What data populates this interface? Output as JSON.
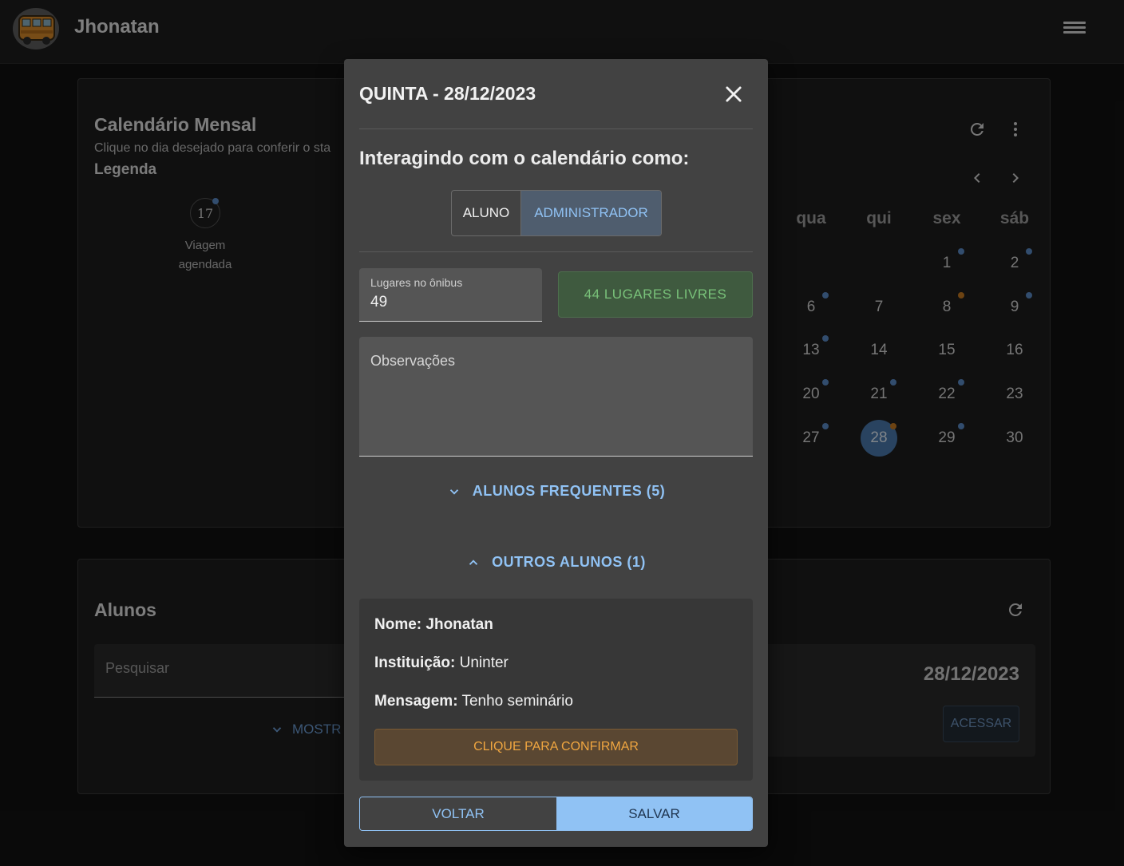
{
  "app": {
    "title": "Jhonatan"
  },
  "calendar": {
    "title": "Calendário Mensal",
    "subtitle": "Clique no dia desejado para conferir o sta",
    "legend_title": "Legenda",
    "legend_day": "17",
    "legend_label": "Viagem agendada",
    "weekdays": [
      "qua",
      "qui",
      "sex",
      "sáb"
    ],
    "rows": [
      [
        "",
        "",
        "1",
        "2"
      ],
      [
        "6",
        "7",
        "8",
        "9"
      ],
      [
        "13",
        "14",
        "15",
        "16"
      ],
      [
        "20",
        "21",
        "22",
        "23"
      ],
      [
        "27",
        "28",
        "29",
        "30"
      ]
    ],
    "selected_day": "28",
    "colors": {
      "scheduled": "#5b8dc9",
      "pending": "#c77a22",
      "selected": "#4b7bb0"
    }
  },
  "alunos": {
    "title": "Alunos",
    "search_placeholder": "Pesquisar",
    "show_more": "MOSTR",
    "trip_date": "28/12/2023",
    "access_label": "ACESSAR"
  },
  "dialog": {
    "title": "QUINTA - 28/12/2023",
    "interacting_label": "Interagindo com o calendário como:",
    "roles": {
      "aluno": "ALUNO",
      "admin": "ADMINISTRADOR",
      "selected": "ADMINISTRADOR"
    },
    "seats_label": "Lugares no ônibus",
    "seats_value": "49",
    "free_seats": "44 LUGARES LIVRES",
    "observations_placeholder": "Observações",
    "frequent_students": "ALUNOS FREQUENTES (5)",
    "other_students": "OUTROS ALUNOS (1)",
    "student": {
      "name_label": "Nome:",
      "name": "Jhonatan",
      "institution_label": "Instituição:",
      "institution": "Uninter",
      "message_label": "Mensagem:",
      "message": "Tenho seminário",
      "confirm_label": "CLIQUE PARA CONFIRMAR"
    },
    "back_label": "VOLTAR",
    "save_label": "SALVAR"
  }
}
